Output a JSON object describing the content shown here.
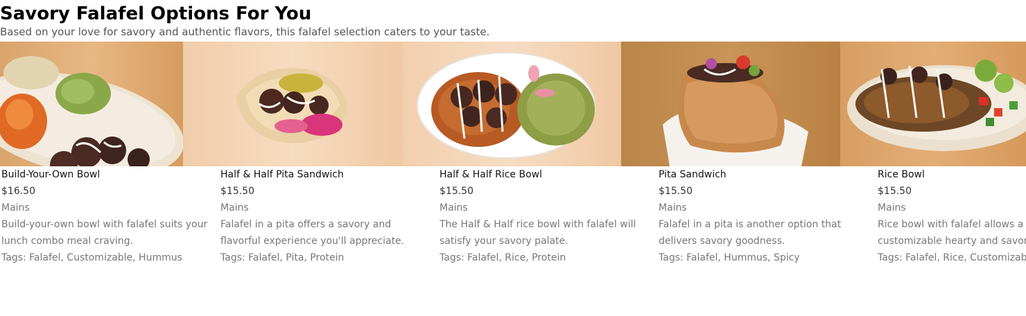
{
  "header": {
    "title": "Savory Falafel Options For You",
    "subtitle": "Based on your love for savory and authentic flavors, this falafel selection caters to your taste."
  },
  "items": [
    {
      "name": "Build-Your-Own Bowl",
      "price": "$16.50",
      "category": "Mains",
      "description": "Build-your-own bowl with falafel suits your lunch combo meal craving.",
      "tags": "Tags: Falafel, Customizable, Hummus"
    },
    {
      "name": "Half & Half Pita Sandwich",
      "price": "$15.50",
      "category": "Mains",
      "description": "Falafel in a pita offers a savory and flavorful experience you'll appreciate.",
      "tags": "Tags: Falafel, Pita, Protein"
    },
    {
      "name": "Half & Half Rice Bowl",
      "price": "$15.50",
      "category": "Mains",
      "description": "The Half & Half rice bowl with falafel will satisfy your savory palate.",
      "tags": "Tags: Falafel, Rice, Protein"
    },
    {
      "name": "Pita Sandwich",
      "price": "$15.50",
      "category": "Mains",
      "description": "Falafel in a pita is another option that delivers savory goodness.",
      "tags": "Tags: Falafel, Hummus, Spicy"
    },
    {
      "name": "Rice Bowl",
      "price": "$15.50",
      "category": "Mains",
      "description": "Rice bowl with falafel allows a customizable hearty and savory meal.",
      "tags": "Tags: Falafel, Rice, Customizable"
    }
  ]
}
